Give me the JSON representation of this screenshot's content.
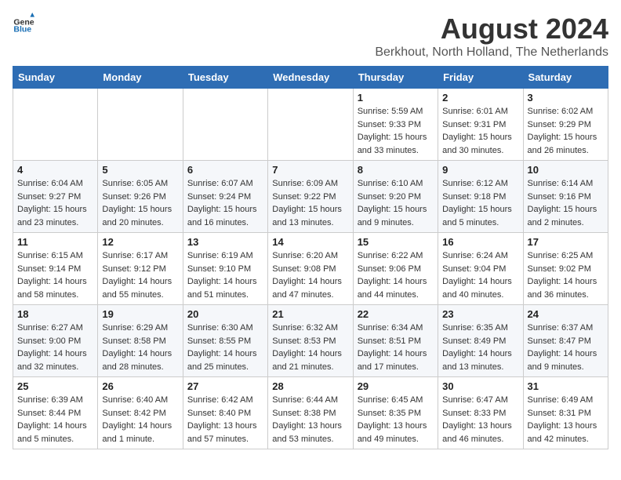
{
  "header": {
    "logo_general": "General",
    "logo_blue": "Blue",
    "month_title": "August 2024",
    "location": "Berkhout, North Holland, The Netherlands"
  },
  "weekdays": [
    "Sunday",
    "Monday",
    "Tuesday",
    "Wednesday",
    "Thursday",
    "Friday",
    "Saturday"
  ],
  "weeks": [
    [
      {
        "day": "",
        "info": ""
      },
      {
        "day": "",
        "info": ""
      },
      {
        "day": "",
        "info": ""
      },
      {
        "day": "",
        "info": ""
      },
      {
        "day": "1",
        "info": "Sunrise: 5:59 AM\nSunset: 9:33 PM\nDaylight: 15 hours\nand 33 minutes."
      },
      {
        "day": "2",
        "info": "Sunrise: 6:01 AM\nSunset: 9:31 PM\nDaylight: 15 hours\nand 30 minutes."
      },
      {
        "day": "3",
        "info": "Sunrise: 6:02 AM\nSunset: 9:29 PM\nDaylight: 15 hours\nand 26 minutes."
      }
    ],
    [
      {
        "day": "4",
        "info": "Sunrise: 6:04 AM\nSunset: 9:27 PM\nDaylight: 15 hours\nand 23 minutes."
      },
      {
        "day": "5",
        "info": "Sunrise: 6:05 AM\nSunset: 9:26 PM\nDaylight: 15 hours\nand 20 minutes."
      },
      {
        "day": "6",
        "info": "Sunrise: 6:07 AM\nSunset: 9:24 PM\nDaylight: 15 hours\nand 16 minutes."
      },
      {
        "day": "7",
        "info": "Sunrise: 6:09 AM\nSunset: 9:22 PM\nDaylight: 15 hours\nand 13 minutes."
      },
      {
        "day": "8",
        "info": "Sunrise: 6:10 AM\nSunset: 9:20 PM\nDaylight: 15 hours\nand 9 minutes."
      },
      {
        "day": "9",
        "info": "Sunrise: 6:12 AM\nSunset: 9:18 PM\nDaylight: 15 hours\nand 5 minutes."
      },
      {
        "day": "10",
        "info": "Sunrise: 6:14 AM\nSunset: 9:16 PM\nDaylight: 15 hours\nand 2 minutes."
      }
    ],
    [
      {
        "day": "11",
        "info": "Sunrise: 6:15 AM\nSunset: 9:14 PM\nDaylight: 14 hours\nand 58 minutes."
      },
      {
        "day": "12",
        "info": "Sunrise: 6:17 AM\nSunset: 9:12 PM\nDaylight: 14 hours\nand 55 minutes."
      },
      {
        "day": "13",
        "info": "Sunrise: 6:19 AM\nSunset: 9:10 PM\nDaylight: 14 hours\nand 51 minutes."
      },
      {
        "day": "14",
        "info": "Sunrise: 6:20 AM\nSunset: 9:08 PM\nDaylight: 14 hours\nand 47 minutes."
      },
      {
        "day": "15",
        "info": "Sunrise: 6:22 AM\nSunset: 9:06 PM\nDaylight: 14 hours\nand 44 minutes."
      },
      {
        "day": "16",
        "info": "Sunrise: 6:24 AM\nSunset: 9:04 PM\nDaylight: 14 hours\nand 40 minutes."
      },
      {
        "day": "17",
        "info": "Sunrise: 6:25 AM\nSunset: 9:02 PM\nDaylight: 14 hours\nand 36 minutes."
      }
    ],
    [
      {
        "day": "18",
        "info": "Sunrise: 6:27 AM\nSunset: 9:00 PM\nDaylight: 14 hours\nand 32 minutes."
      },
      {
        "day": "19",
        "info": "Sunrise: 6:29 AM\nSunset: 8:58 PM\nDaylight: 14 hours\nand 28 minutes."
      },
      {
        "day": "20",
        "info": "Sunrise: 6:30 AM\nSunset: 8:55 PM\nDaylight: 14 hours\nand 25 minutes."
      },
      {
        "day": "21",
        "info": "Sunrise: 6:32 AM\nSunset: 8:53 PM\nDaylight: 14 hours\nand 21 minutes."
      },
      {
        "day": "22",
        "info": "Sunrise: 6:34 AM\nSunset: 8:51 PM\nDaylight: 14 hours\nand 17 minutes."
      },
      {
        "day": "23",
        "info": "Sunrise: 6:35 AM\nSunset: 8:49 PM\nDaylight: 14 hours\nand 13 minutes."
      },
      {
        "day": "24",
        "info": "Sunrise: 6:37 AM\nSunset: 8:47 PM\nDaylight: 14 hours\nand 9 minutes."
      }
    ],
    [
      {
        "day": "25",
        "info": "Sunrise: 6:39 AM\nSunset: 8:44 PM\nDaylight: 14 hours\nand 5 minutes."
      },
      {
        "day": "26",
        "info": "Sunrise: 6:40 AM\nSunset: 8:42 PM\nDaylight: 14 hours\nand 1 minute."
      },
      {
        "day": "27",
        "info": "Sunrise: 6:42 AM\nSunset: 8:40 PM\nDaylight: 13 hours\nand 57 minutes."
      },
      {
        "day": "28",
        "info": "Sunrise: 6:44 AM\nSunset: 8:38 PM\nDaylight: 13 hours\nand 53 minutes."
      },
      {
        "day": "29",
        "info": "Sunrise: 6:45 AM\nSunset: 8:35 PM\nDaylight: 13 hours\nand 49 minutes."
      },
      {
        "day": "30",
        "info": "Sunrise: 6:47 AM\nSunset: 8:33 PM\nDaylight: 13 hours\nand 46 minutes."
      },
      {
        "day": "31",
        "info": "Sunrise: 6:49 AM\nSunset: 8:31 PM\nDaylight: 13 hours\nand 42 minutes."
      }
    ]
  ]
}
